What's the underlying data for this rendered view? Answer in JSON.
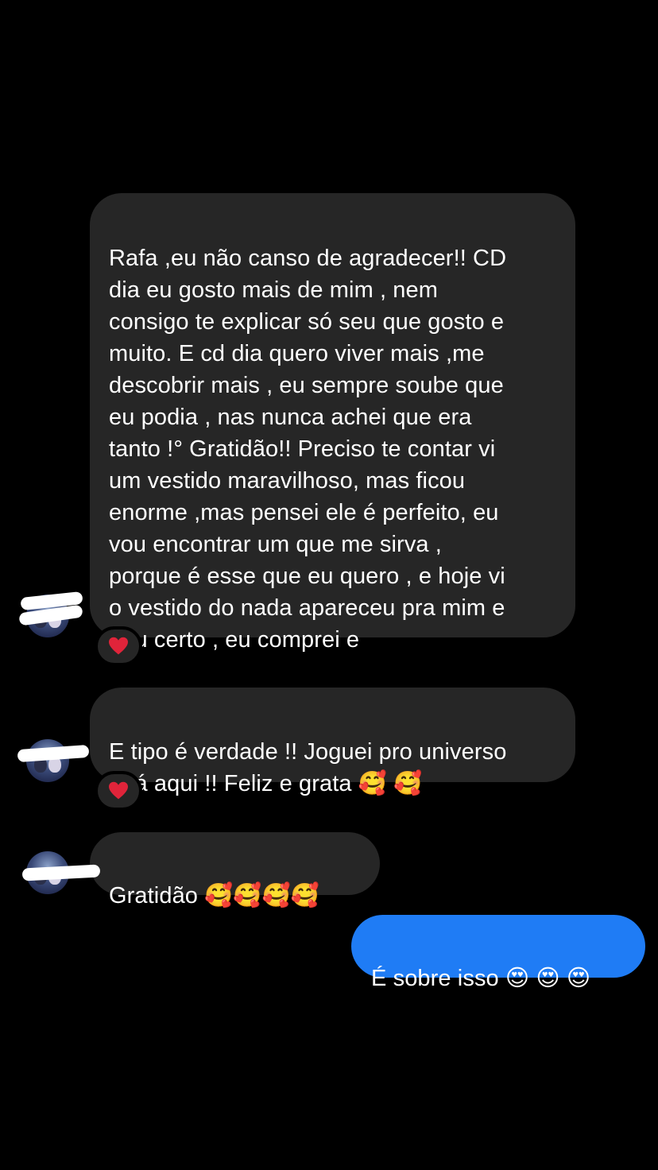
{
  "conversation": {
    "messages": [
      {
        "sender": "other",
        "text": "Rafa ,eu não canso de agradecer!! CD\ndia eu gosto mais de mim , nem\nconsigo te explicar só seu que gosto e\nmuito. E cd dia quero viver mais ,me\ndescobrir mais , eu sempre soube que\neu podia , nas nunca achei que era\ntanto !° Gratidão!! Preciso te contar vi\num vestido maravilhoso,  mas ficou\nenorme ,mas pensei ele é perfeito,  eu\nvou encontrar um que me sirva ,\nporque é esse que eu quero , e hoje vi\no vestido do nada apareceu pra mim e\ndeu certo , eu comprei e",
        "reaction": "❤️"
      },
      {
        "sender": "other",
        "text": "E tipo é verdade !! Joguei pro universo\ne tá aqui !! Feliz e grata 🥰 🥰",
        "reaction": "❤️"
      },
      {
        "sender": "other",
        "text": "Gratidão 🥰🥰🥰🥰"
      },
      {
        "sender": "me",
        "text": "É sobre isso 😍 😍 😍"
      }
    ]
  },
  "colors": {
    "background": "#000000",
    "incoming_bubble": "#262626",
    "outgoing_bubble": "#1f7cf5",
    "heart": "#e0243a"
  },
  "icons": {
    "reaction_1": "heart-icon",
    "reaction_2": "heart-icon"
  }
}
